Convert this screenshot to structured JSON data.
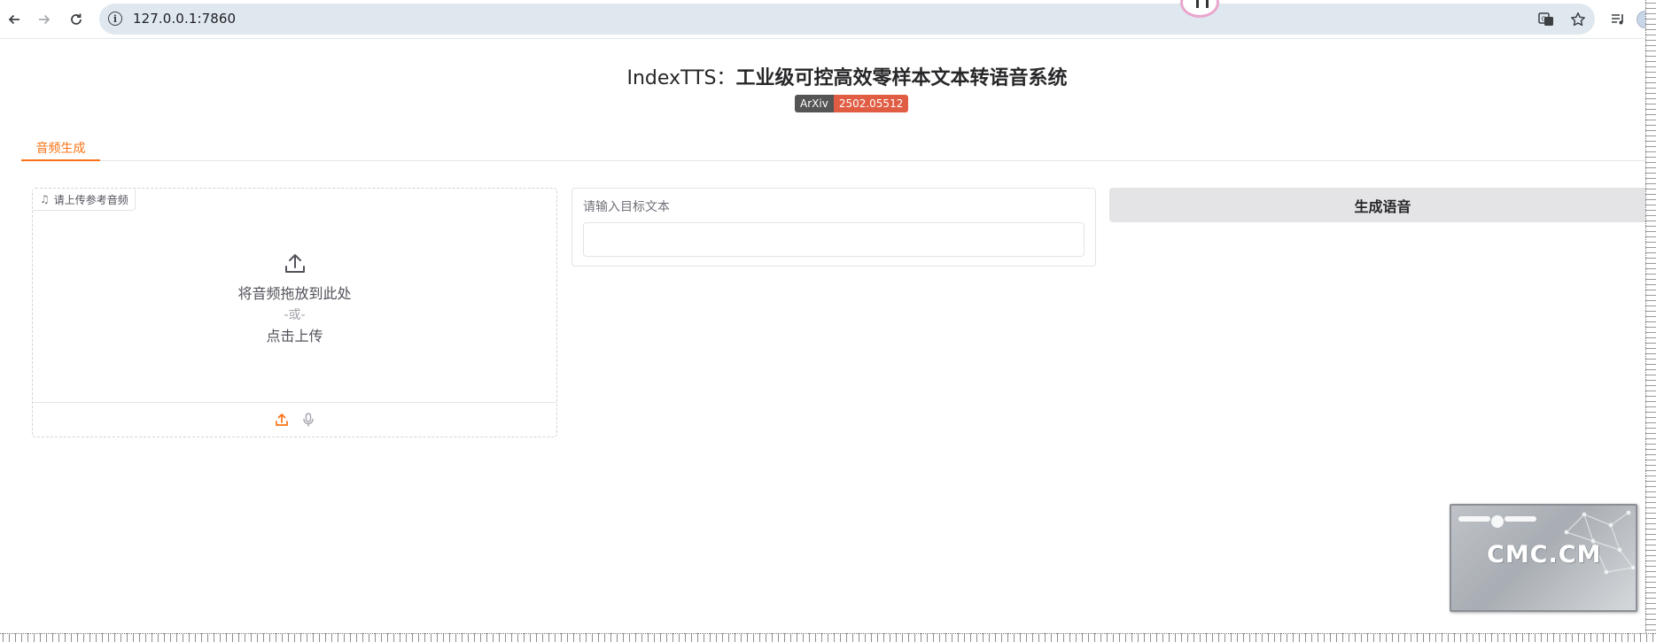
{
  "browser": {
    "url": "127.0.0.1:7860",
    "back_icon": "arrow-left-icon",
    "forward_icon": "arrow-right-icon",
    "reload_icon": "reload-icon",
    "info_icon": "info-icon",
    "translate_icon": "translate-icon",
    "bookmark_icon": "star-icon",
    "media_icon": "media-control-icon"
  },
  "header": {
    "title_prefix": "IndexTTS：",
    "title_main": "工业级可控高效零样本文本转语音系统",
    "badge_left": "ArXiv",
    "badge_right": "2502.05512"
  },
  "tabs": [
    {
      "label": "音频生成",
      "active": true
    }
  ],
  "upload": {
    "label": "请上传参考音频",
    "drop_text": "将音频拖放到此处",
    "or_text": "-或-",
    "click_text": "点击上传"
  },
  "text_input": {
    "label": "请输入目标文本",
    "value": ""
  },
  "generate_button": {
    "label": "生成语音"
  },
  "watermark": {
    "text": "CMC.CM"
  },
  "colors": {
    "accent": "#f97316",
    "badge_dark": "#555555",
    "badge_red": "#e05d44",
    "button_bg": "#e4e4e7",
    "omnibox_bg": "#dfe8ef"
  }
}
